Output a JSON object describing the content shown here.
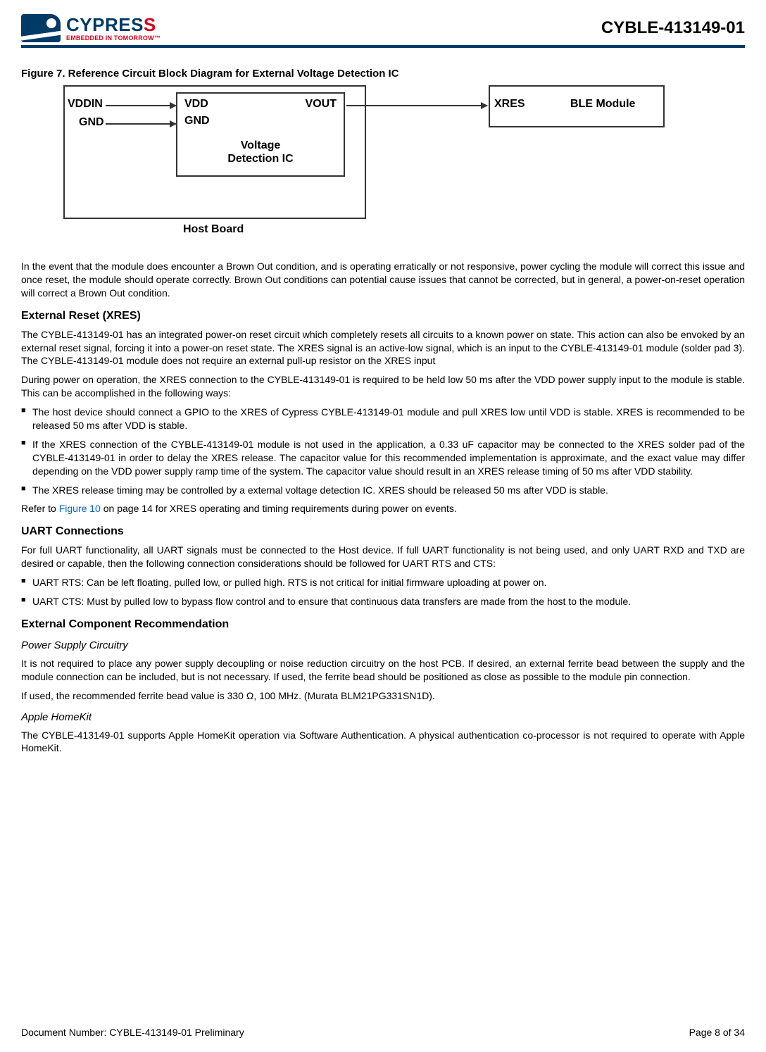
{
  "header": {
    "logo_name_pre": "CYPRES",
    "logo_name_accent": "S",
    "logo_tagline": "EMBEDDED IN TOMORROW™",
    "part_number": "CYBLE-413149-01"
  },
  "figure": {
    "caption": "Figure 7.  Reference Circuit Block Diagram for External Voltage Detection IC",
    "labels": {
      "vddin": "VDDIN",
      "gnd_left": "GND",
      "vdd": "VDD",
      "vout": "VOUT",
      "gnd_mid": "GND",
      "vdic_l1": "Voltage",
      "vdic_l2": "Detection IC",
      "xres": "XRES",
      "ble": "BLE Module",
      "host": "Host Board"
    }
  },
  "body": {
    "p1": "In the event that the module does encounter a Brown Out condition, and is operating erratically or not responsive, power cycling the module will correct this issue and once reset, the module should operate correctly. Brown Out conditions can potential cause issues that cannot be corrected, but in general, a power-on-reset operation will correct a Brown Out condition.",
    "h_xres": "External Reset (XRES)",
    "p2": "The CYBLE-413149-01 has an integrated power-on reset circuit which completely resets all circuits to a known power on state. This action can also be envoked by an external reset signal, forcing it into a power-on reset state. The XRES signal is an active-low signal, which is an input to the CYBLE-413149-01 module (solder pad 3). The CYBLE-413149-01 module does not require an external pull-up resistor on the XRES input",
    "p3": "During power on operation, the XRES connection to the CYBLE-413149-01 is required to be held low 50 ms after the VDD power supply input to the module is stable. This can be accomplished in the following ways:",
    "b1": "The host device should connect a GPIO to the XRES of Cypress CYBLE-413149-01 module and pull XRES low until VDD is stable. XRES is recommended to be released 50 ms after VDD is stable.",
    "b2": "If the XRES connection of the CYBLE-413149-01 module is not used in the application, a 0.33 uF capacitor may be connected to the XRES solder pad of the CYBLE-413149-01 in order to delay the XRES release. The capacitor value for this recommended implementation is approximate, and the exact value may differ depending on the VDD power supply ramp time of the system. The capacitor value should result in an XRES release timing of 50 ms after VDD stability.",
    "b3": "The XRES release timing may be controlled by a external voltage detection IC. XRES should be released 50 ms after VDD is stable.",
    "p4_pre": "Refer to ",
    "p4_link": "Figure 10",
    "p4_post": " on page 14 for XRES operating and timing requirements during power on events.",
    "h_uart": "UART Connections",
    "p5": "For full UART functionality, all UART signals must be connected to the Host device. If full UART functionality is not being used, and only UART RXD and TXD are desired or capable, then the following connection considerations should be followed for UART RTS and CTS:",
    "b4": "UART RTS: Can be left floating, pulled low, or pulled high. RTS is not critical for initial firmware uploading at power on.",
    "b5": "UART CTS: Must by pulled low to bypass flow control and to ensure that continuous data transfers are made from the host to the module.",
    "h_ext": "External Component Recommendation",
    "h_psc": "Power Supply Circuitry",
    "p6": "It is not required to place any power supply decoupling or noise reduction circuitry on the host PCB. If desired, an external ferrite bead between the supply and the module connection can be included, but is not necessary. If used, the ferrite bead should be positioned as close as possible to the module pin connection.",
    "p7": "If used, the recommended ferrite bead value is 330 Ω, 100 MHz. (Murata BLM21PG331SN1D).",
    "h_hk": "Apple HomeKit",
    "p8": "The CYBLE-413149-01 supports Apple HomeKit operation via Software Authentication. A physical authentication co-processor is not required to operate with Apple HomeKit."
  },
  "footer": {
    "doc_number": "Document Number:  CYBLE-413149-01 Preliminary",
    "page": "Page 8 of 34"
  }
}
